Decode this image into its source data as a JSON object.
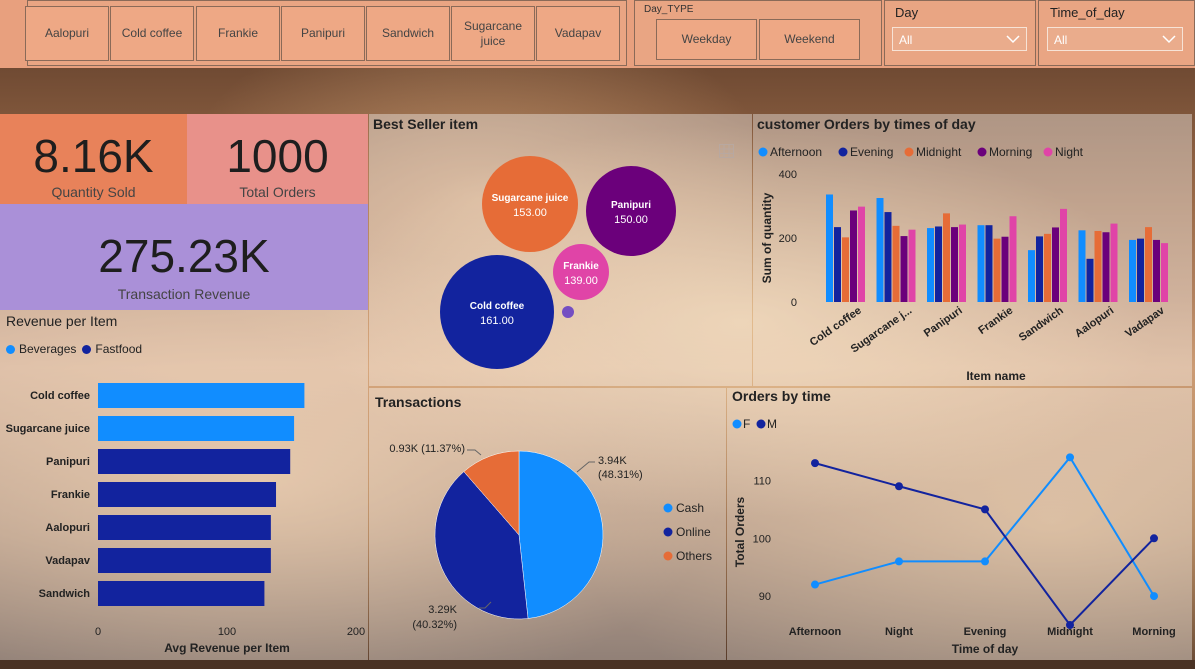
{
  "item_slicer": {
    "items": [
      "Aalopuri",
      "Cold coffee",
      "Frankie",
      "Panipuri",
      "Sandwich",
      "Sugarcane juice",
      "Vadapav"
    ]
  },
  "day_type_slicer": {
    "title": "Day_TYPE",
    "options": [
      "Weekday",
      "Weekend"
    ]
  },
  "day_filter": {
    "title": "Day",
    "value": "All"
  },
  "time_filter": {
    "title": "Time_of_day",
    "value": "All"
  },
  "kpis": {
    "quantity": {
      "value": "8.16K",
      "label": "Quantity Sold"
    },
    "orders": {
      "value": "1000",
      "label": "Total Orders"
    },
    "revenue": {
      "value": "275.23K",
      "label": "Transaction Revenue"
    }
  },
  "colors": {
    "light_blue": "#118dff",
    "dark_blue": "#12239e",
    "orange": "#e66c37",
    "purple": "#6b007b",
    "pink": "#e044a7",
    "violet": "#744ec2"
  },
  "best_seller": {
    "title": "Best Seller item",
    "icon": "table-icon",
    "bubbles": [
      {
        "name": "Sugarcane juice",
        "value": "153.00",
        "color": "#e66c37"
      },
      {
        "name": "Panipuri",
        "value": "150.00",
        "color": "#6b007b"
      },
      {
        "name": "Frankie",
        "value": "139.00",
        "color": "#e044a7"
      },
      {
        "name": "Cold coffee",
        "value": "161.00",
        "color": "#12239e"
      }
    ]
  },
  "chart_data": [
    {
      "type": "bar",
      "orientation": "horizontal",
      "title": "Revenue per Item",
      "xlabel": "Avg Revenue per Item",
      "ylabel": "",
      "xlim": [
        0,
        200
      ],
      "xticks": [
        "0",
        "100",
        "200"
      ],
      "legend": [
        {
          "name": "Beverages",
          "color": "#118dff"
        },
        {
          "name": "Fastfood",
          "color": "#12239e"
        }
      ],
      "categories": [
        "Cold coffee",
        "Sugarcane juice",
        "Panipuri",
        "Frankie",
        "Aalopuri",
        "Vadapav",
        "Sandwich"
      ],
      "values": [
        160,
        152,
        149,
        138,
        134,
        134,
        129
      ],
      "groups": [
        "Beverages",
        "Beverages",
        "Fastfood",
        "Fastfood",
        "Fastfood",
        "Fastfood",
        "Fastfood"
      ]
    },
    {
      "type": "bar",
      "title": "customer Orders by times of day",
      "xlabel": "Item name",
      "ylabel": "Sum of quantity",
      "ylim": [
        0,
        400
      ],
      "yticks": [
        "0",
        "200",
        "400"
      ],
      "categories": [
        "Cold coffee",
        "Sugarcane j...",
        "Panipuri",
        "Frankie",
        "Sandwich",
        "Aalopuri",
        "Vadapav"
      ],
      "series": [
        {
          "name": "Afternoon",
          "color": "#118dff",
          "values": [
            336,
            325,
            231,
            240,
            162,
            224,
            194
          ]
        },
        {
          "name": "Evening",
          "color": "#12239e",
          "values": [
            234,
            281,
            236,
            240,
            205,
            135,
            198
          ]
        },
        {
          "name": "Midnight",
          "color": "#e66c37",
          "values": [
            202,
            238,
            277,
            198,
            213,
            222,
            234
          ]
        },
        {
          "name": "Morning",
          "color": "#6b007b",
          "values": [
            286,
            206,
            234,
            204,
            233,
            218,
            194
          ]
        },
        {
          "name": "Night",
          "color": "#e044a7",
          "values": [
            298,
            226,
            242,
            268,
            291,
            245,
            184
          ]
        }
      ]
    },
    {
      "type": "pie",
      "title": "Transactions",
      "slices": [
        {
          "name": "Cash",
          "value": 3.94,
          "label": "3.94K",
          "pct": "(48.31%)",
          "color": "#118dff"
        },
        {
          "name": "Online",
          "value": 3.29,
          "label": "3.29K",
          "pct": "(40.32%)",
          "color": "#12239e"
        },
        {
          "name": "Others",
          "value": 0.93,
          "label": "0.93K (11.37%)",
          "pct": "",
          "color": "#e66c37"
        }
      ]
    },
    {
      "type": "line",
      "title": "Orders by time",
      "xlabel": "Time of day",
      "ylabel": "Total Orders",
      "ylim": [
        85,
        117
      ],
      "yticks": [
        90,
        100,
        110
      ],
      "categories": [
        "Afternoon",
        "Night",
        "Evening",
        "Midnight",
        "Morning"
      ],
      "legend_marks": [
        "F",
        "M"
      ],
      "series": [
        {
          "name": "F",
          "color": "#118dff",
          "values": [
            92,
            96,
            96,
            114,
            90
          ]
        },
        {
          "name": "M",
          "color": "#12239e",
          "values": [
            113,
            109,
            105,
            85,
            100
          ]
        }
      ]
    }
  ]
}
